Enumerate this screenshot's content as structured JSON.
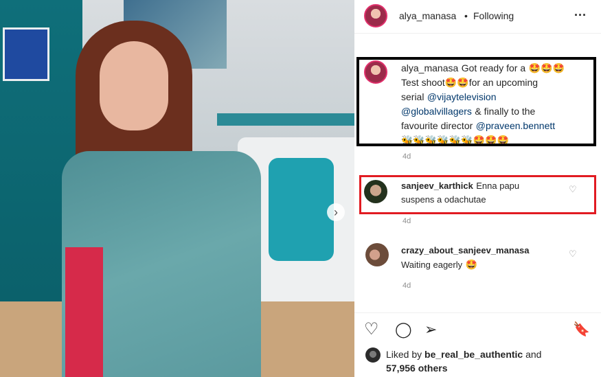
{
  "photo": {
    "next_arrow": "›"
  },
  "header": {
    "username": "alya_manasa",
    "separator": "•",
    "follow_status": "Following",
    "more": "···"
  },
  "caption": {
    "username": "alya_manasa",
    "text_1": "Got ready for a",
    "emoji_1": "🤩🤩🤩",
    "text_2": "Test shoot",
    "emoji_2": "🤩🤩",
    "text_3": "for an upcoming",
    "text_4": "serial",
    "mention_1": "@vijaytelevision",
    "mention_2": "@globalvillagers",
    "text_5": "& finally to the",
    "text_6": "favourite director",
    "mention_3": "@praveen.bennett",
    "emoji_row": "🐝🐝🐝🐝🐝🐝🤩🤩🤩",
    "time": "4d"
  },
  "comments": [
    {
      "username": "sanjeev_karthick",
      "text_a": "Enna papu",
      "text_b": "suspens a odachutae",
      "time": "4d"
    },
    {
      "username": "crazy_about_sanjeev_manasa",
      "text_a": "Waiting eagerly",
      "emoji": "🤩",
      "time": "4d"
    }
  ],
  "likes": {
    "prefix": "Liked by",
    "user": "be_real_be_authentic",
    "and": "and",
    "count": "57,956 others"
  },
  "icons": {
    "heart": "♡",
    "comment": "◯",
    "share": "➢",
    "bookmark": "🔖"
  }
}
